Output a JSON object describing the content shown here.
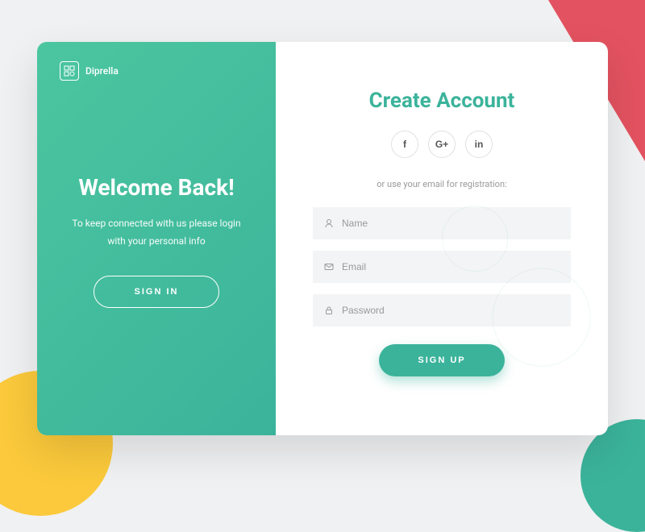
{
  "brand": "Diprella",
  "left": {
    "title": "Welcome Back!",
    "subtitle": "To keep connected with us please login with your personal info",
    "signin_label": "SIGN IN"
  },
  "right": {
    "title": "Create Account",
    "divider": "or use your email for registration:",
    "fields": {
      "name_placeholder": "Name",
      "email_placeholder": "Email",
      "password_placeholder": "Password"
    },
    "signup_label": "SIGN UP",
    "social": {
      "facebook": "f",
      "google": "G+",
      "linkedin": "in"
    }
  }
}
